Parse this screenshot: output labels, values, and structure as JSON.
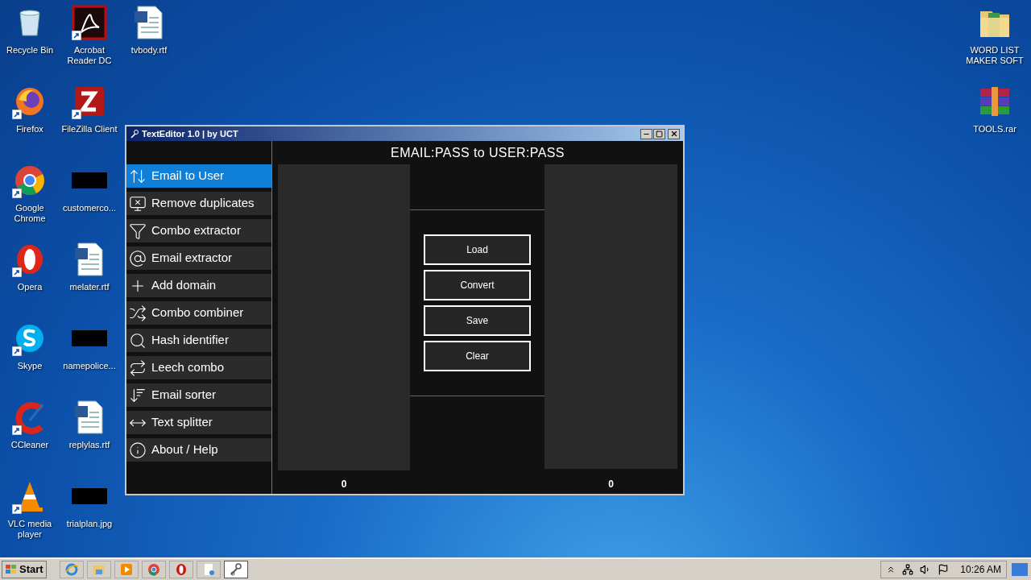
{
  "desktop": {
    "columns": [
      [
        {
          "label": "Recycle Bin",
          "kind": "recycle",
          "shortcut": false
        },
        {
          "label": "Firefox",
          "kind": "firefox",
          "shortcut": true
        },
        {
          "label": "Google Chrome",
          "kind": "chrome",
          "shortcut": true
        },
        {
          "label": "Opera",
          "kind": "opera",
          "shortcut": true
        },
        {
          "label": "Skype",
          "kind": "skype",
          "shortcut": true
        },
        {
          "label": "CCleaner",
          "kind": "ccleaner",
          "shortcut": true
        },
        {
          "label": "VLC media player",
          "kind": "vlc",
          "shortcut": true
        }
      ],
      [
        {
          "label": "Acrobat Reader DC",
          "kind": "acrobat",
          "shortcut": true
        },
        {
          "label": "FileZilla Client",
          "kind": "filezilla",
          "shortcut": true
        },
        {
          "label": "customerco...",
          "kind": "blank",
          "shortcut": false
        },
        {
          "label": "melater.rtf",
          "kind": "word",
          "shortcut": false
        },
        {
          "label": "namepolice...",
          "kind": "blank",
          "shortcut": false
        },
        {
          "label": "replylas.rtf",
          "kind": "word",
          "shortcut": false
        },
        {
          "label": "trialplan.jpg",
          "kind": "blank",
          "shortcut": false
        }
      ],
      [
        {
          "label": "tvbody.rtf",
          "kind": "word",
          "shortcut": false
        }
      ]
    ],
    "right_icons": [
      {
        "label": "WORD LIST MAKER SOFT",
        "kind": "folder",
        "shortcut": false
      },
      {
        "label": "TOOLS.rar",
        "kind": "rar",
        "shortcut": false
      }
    ]
  },
  "window": {
    "title": "TextEditor 1.0 | by UCT",
    "heading": "EMAIL:PASS to USER:PASS",
    "sidebar": [
      {
        "label": "Email to User",
        "kind": "swap",
        "selected": true
      },
      {
        "label": "Remove duplicates",
        "kind": "dedupe",
        "selected": false
      },
      {
        "label": "Combo extractor",
        "kind": "funnel",
        "selected": false
      },
      {
        "label": "Email extractor",
        "kind": "at",
        "selected": false
      },
      {
        "label": "Add domain",
        "kind": "plus",
        "selected": false
      },
      {
        "label": "Combo combiner",
        "kind": "shuffle",
        "selected": false
      },
      {
        "label": "Hash identifier",
        "kind": "search",
        "selected": false
      },
      {
        "label": "Leech combo",
        "kind": "repeat",
        "selected": false
      },
      {
        "label": "Email sorter",
        "kind": "sort",
        "selected": false
      },
      {
        "label": "Text splitter",
        "kind": "split",
        "selected": false
      },
      {
        "label": "About / Help",
        "kind": "info",
        "selected": false
      }
    ],
    "buttons": [
      "Load",
      "Convert",
      "Save",
      "Clear"
    ],
    "input_count": "0",
    "output_count": "0"
  },
  "taskbar": {
    "start": "Start",
    "apps": [
      {
        "kind": "ie",
        "active": false
      },
      {
        "kind": "explorer",
        "active": false
      },
      {
        "kind": "media",
        "active": false
      },
      {
        "kind": "chrome",
        "active": false
      },
      {
        "kind": "opera",
        "active": false
      },
      {
        "kind": "doc",
        "active": false
      },
      {
        "kind": "tool",
        "active": true
      }
    ],
    "clock": "10:26 AM"
  }
}
